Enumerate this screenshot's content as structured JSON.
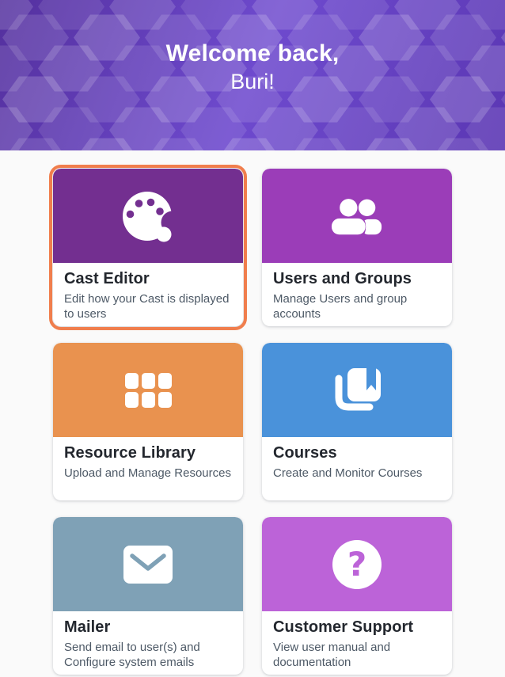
{
  "page": {
    "background": "#FAFAFA"
  },
  "header": {
    "greeting_line1": "Welcome back,",
    "greeting_line2": "Buri!",
    "colors": {
      "bg_start": "#54309E",
      "bg_mid": "#6E4ACE",
      "bg_end": "#5B37B3",
      "hexagon": "#FFFFFF",
      "text": "#FFFFFF"
    }
  },
  "highlight": {
    "border_color": "#F07E4D"
  },
  "cards": [
    {
      "title": "Cast Editor",
      "description": "Edit how your Cast is displayed to users",
      "color": "#732F90",
      "icon": "palette-icon",
      "highlighted": true
    },
    {
      "title": "Users and Groups",
      "description": "Manage Users and group accounts",
      "color": "#9B3DB8",
      "icon": "users-icon",
      "highlighted": false
    },
    {
      "title": "Resource Library",
      "description": "Upload and Manage Resources",
      "color": "#E9924F",
      "icon": "grid-icon",
      "highlighted": false
    },
    {
      "title": "Courses",
      "description": "Create and Monitor Courses",
      "color": "#4A92DA",
      "icon": "book-icon",
      "highlighted": false
    },
    {
      "title": "Mailer",
      "description": "Send email to user(s) and Configure system emails",
      "color": "#7FA1B6",
      "icon": "mail-icon",
      "highlighted": false
    },
    {
      "title": "Customer Support",
      "description": "View user manual and documentation",
      "color": "#BC63D8",
      "icon": "question-icon",
      "highlighted": false
    }
  ]
}
